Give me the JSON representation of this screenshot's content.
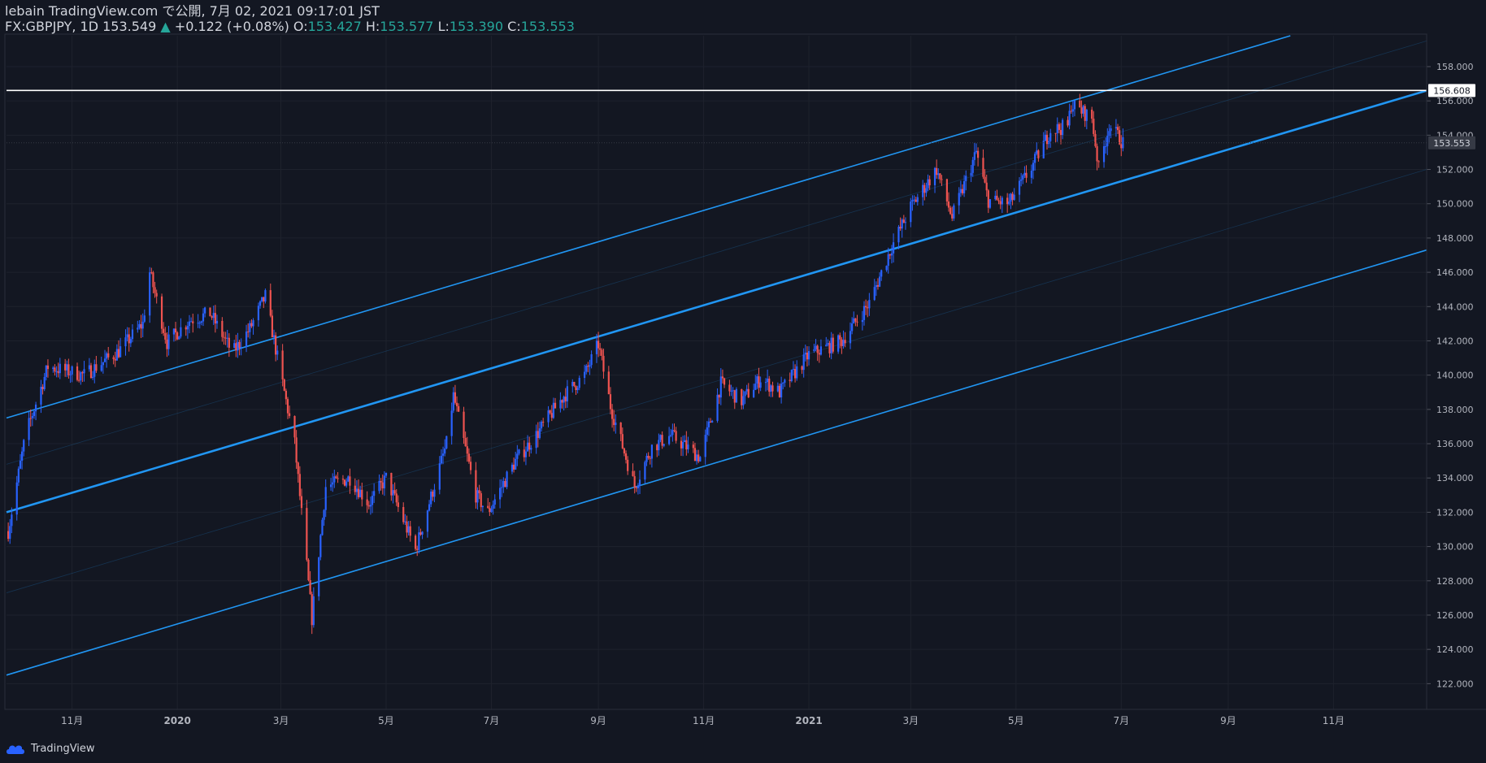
{
  "header": {
    "publish_line": "lebain TradingView.com で公開, 7月 02, 2021 09:17:01 JST",
    "symbol_line": "FX:GBPJPY, 1D 153.549",
    "change_arrow": "▲",
    "change_text": "+0.122 (+0.08%)",
    "o_label": "O:",
    "o_value": "153.427",
    "h_label": "H:",
    "h_value": "153.577",
    "l_label": "L:",
    "l_value": "153.390",
    "c_label": "C:",
    "c_value": "153.553"
  },
  "footer": {
    "brand": "TradingView",
    "logo_icon": "tradingview-cloud-icon"
  },
  "colors": {
    "background": "#131722",
    "bull": "#2962ff",
    "bear": "#ef5350",
    "channel": "#2196f3",
    "grid": "#1e222d",
    "axis_text": "#b2b5be",
    "up": "#26a69a"
  },
  "chart_data": {
    "type": "candlestick",
    "symbol": "FX:GBPJPY",
    "interval": "1D",
    "y_axis": {
      "side": "right",
      "range": [
        120.5,
        159.8
      ],
      "ticks": [
        "122.000",
        "124.000",
        "126.000",
        "128.000",
        "130.000",
        "132.000",
        "134.000",
        "136.000",
        "138.000",
        "140.000",
        "142.000",
        "144.000",
        "146.000",
        "148.000",
        "150.000",
        "152.000",
        "154.000",
        "156.000",
        "158.000"
      ]
    },
    "x_axis": {
      "range": [
        "2019-09-24",
        "2021-12-25"
      ],
      "ticks": [
        {
          "label": "11月",
          "date": "2019-11-01"
        },
        {
          "label": "2020",
          "date": "2020-01-01"
        },
        {
          "label": "3月",
          "date": "2020-03-01"
        },
        {
          "label": "5月",
          "date": "2020-05-01"
        },
        {
          "label": "7月",
          "date": "2020-07-01"
        },
        {
          "label": "9月",
          "date": "2020-09-01"
        },
        {
          "label": "11月",
          "date": "2020-11-01"
        },
        {
          "label": "2021",
          "date": "2021-01-01"
        },
        {
          "label": "3月",
          "date": "2021-03-01"
        },
        {
          "label": "5月",
          "date": "2021-05-01"
        },
        {
          "label": "7月",
          "date": "2021-07-01"
        },
        {
          "label": "9月",
          "date": "2021-09-01"
        },
        {
          "label": "11月",
          "date": "2021-11-01"
        }
      ]
    },
    "price_labels": {
      "horizontal_line": "156.608",
      "last_price": "153.553"
    },
    "horizontal_line_value": 156.608,
    "last_price_value": 153.553,
    "key_points": [
      {
        "date": "2019-09-25",
        "close": 130.9
      },
      {
        "date": "2019-10-05",
        "close": 136.5
      },
      {
        "date": "2019-10-18",
        "close": 140.5
      },
      {
        "date": "2019-11-08",
        "close": 140.0
      },
      {
        "date": "2019-11-28",
        "close": 141.4
      },
      {
        "date": "2019-12-12",
        "close": 143.0
      },
      {
        "date": "2019-12-16",
        "close": 146.0
      },
      {
        "date": "2019-12-26",
        "close": 141.9
      },
      {
        "date": "2020-01-08",
        "close": 143.2
      },
      {
        "date": "2020-01-20",
        "close": 143.6
      },
      {
        "date": "2020-02-02",
        "close": 141.3
      },
      {
        "date": "2020-02-12",
        "close": 142.7
      },
      {
        "date": "2020-02-21",
        "close": 144.6
      },
      {
        "date": "2020-03-01",
        "close": 140.0
      },
      {
        "date": "2020-03-09",
        "close": 136.0
      },
      {
        "date": "2020-03-19",
        "close": 125.8
      },
      {
        "date": "2020-03-27",
        "close": 133.5
      },
      {
        "date": "2020-04-10",
        "close": 134.0
      },
      {
        "date": "2020-04-21",
        "close": 132.5
      },
      {
        "date": "2020-05-01",
        "close": 134.0
      },
      {
        "date": "2020-05-18",
        "close": 129.8
      },
      {
        "date": "2020-06-05",
        "close": 136.0
      },
      {
        "date": "2020-06-09",
        "close": 138.8
      },
      {
        "date": "2020-06-22",
        "close": 133.0
      },
      {
        "date": "2020-06-29",
        "close": 132.0
      },
      {
        "date": "2020-07-15",
        "close": 135.0
      },
      {
        "date": "2020-07-27",
        "close": 136.5
      },
      {
        "date": "2020-08-12",
        "close": 138.8
      },
      {
        "date": "2020-08-24",
        "close": 140.0
      },
      {
        "date": "2020-09-01",
        "close": 141.8
      },
      {
        "date": "2020-09-08",
        "close": 138.2
      },
      {
        "date": "2020-09-22",
        "close": 133.5
      },
      {
        "date": "2020-10-02",
        "close": 135.8
      },
      {
        "date": "2020-10-13",
        "close": 136.5
      },
      {
        "date": "2020-10-30",
        "close": 135.2
      },
      {
        "date": "2020-11-11",
        "close": 139.5
      },
      {
        "date": "2020-11-23",
        "close": 138.5
      },
      {
        "date": "2020-12-04",
        "close": 139.8
      },
      {
        "date": "2020-12-15",
        "close": 139.0
      },
      {
        "date": "2021-01-01",
        "close": 141.2
      },
      {
        "date": "2021-01-20",
        "close": 142.0
      },
      {
        "date": "2021-02-05",
        "close": 144.2
      },
      {
        "date": "2021-02-18",
        "close": 147.5
      },
      {
        "date": "2021-03-01",
        "close": 149.8
      },
      {
        "date": "2021-03-16",
        "close": 152.0
      },
      {
        "date": "2021-03-25",
        "close": 149.2
      },
      {
        "date": "2021-04-08",
        "close": 153.0
      },
      {
        "date": "2021-04-15",
        "close": 150.2
      },
      {
        "date": "2021-04-27",
        "close": 150.0
      },
      {
        "date": "2021-05-11",
        "close": 152.3
      },
      {
        "date": "2021-05-21",
        "close": 154.3
      },
      {
        "date": "2021-05-31",
        "close": 154.5
      },
      {
        "date": "2021-06-02",
        "close": 155.8
      },
      {
        "date": "2021-06-14",
        "close": 155.0
      },
      {
        "date": "2021-06-18",
        "close": 152.0
      },
      {
        "date": "2021-06-24",
        "close": 154.6
      },
      {
        "date": "2021-07-02",
        "close": 153.55
      }
    ],
    "channels": [
      {
        "name": "",
        "start": {
          "date": "2019-09-24",
          "price": 137.5
        },
        "end": {
          "date": "2021-10-07",
          "price": 159.8
        },
        "weight": "normal"
      },
      {
        "name": "",
        "start": {
          "date": "2019-09-24",
          "price": 132.0
        },
        "end": {
          "date": "2021-12-25",
          "price": 156.6
        },
        "weight": "bold"
      },
      {
        "name": "",
        "start": {
          "date": "2019-09-24",
          "price": 122.5
        },
        "end": {
          "date": "2021-12-25",
          "price": 147.3
        },
        "weight": "normal"
      },
      {
        "name": "",
        "start": {
          "date": "2019-09-24",
          "price": 134.8
        },
        "end": {
          "date": "2021-12-25",
          "price": 159.5
        },
        "weight": "faint"
      },
      {
        "name": "",
        "start": {
          "date": "2019-09-24",
          "price": 127.3
        },
        "end": {
          "date": "2021-12-25",
          "price": 152.0
        },
        "weight": "faint"
      }
    ]
  }
}
